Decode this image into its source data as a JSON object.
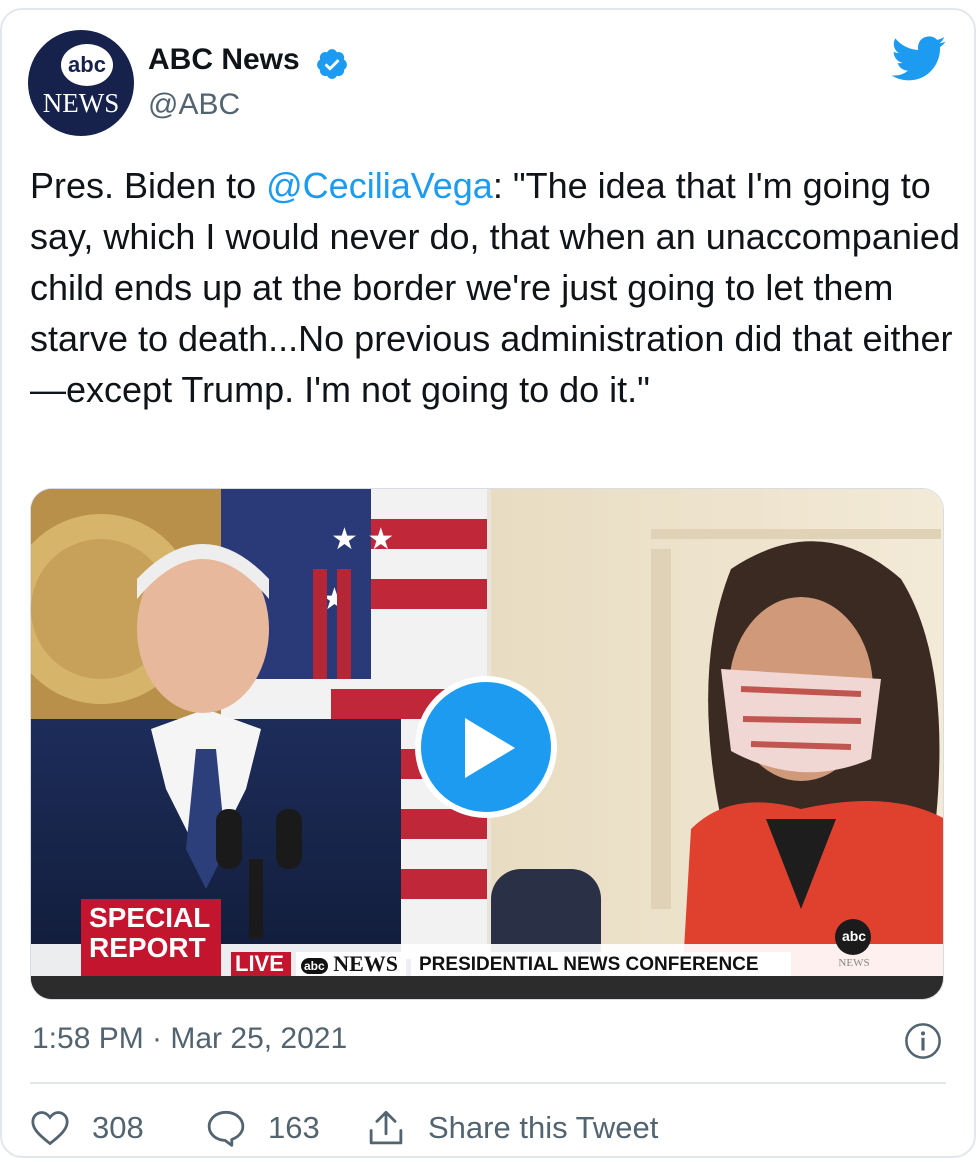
{
  "account": {
    "display_name": "ABC News",
    "handle": "@ABC",
    "verified": true,
    "avatar_top": "abc",
    "avatar_bottom": "NEWS",
    "avatar_color": "#16224c"
  },
  "platform_icon": "twitter-bird-icon",
  "tweet": {
    "text_before": "Pres. Biden to ",
    "mention": "@CeciliaVega",
    "text_after": ": \"The idea that I'm going to say, which I would never do, that when an unaccompanied child ends up at the border we're just going to let them starve to death...No previous administration did that either—except Trump. I'm not going to do it.\""
  },
  "video": {
    "lower_third": {
      "badge_line1": "SPECIAL",
      "badge_line2": "REPORT",
      "live_label": "LIVE",
      "network_label": "NEWS",
      "network_prefix": "abc",
      "headline": "PRESIDENTIAL NEWS CONFERENCE",
      "corner_logo_top": "abc",
      "corner_logo_bottom": "NEWS"
    },
    "play_icon": "play-icon"
  },
  "timestamp": "1:58 PM · Mar 25, 2021",
  "actions": {
    "likes": "308",
    "replies": "163",
    "share_label": "Share this Tweet"
  },
  "colors": {
    "accent": "#1d9bf0",
    "muted": "#536471",
    "text": "#0f1419",
    "border": "#e1e8ed"
  }
}
